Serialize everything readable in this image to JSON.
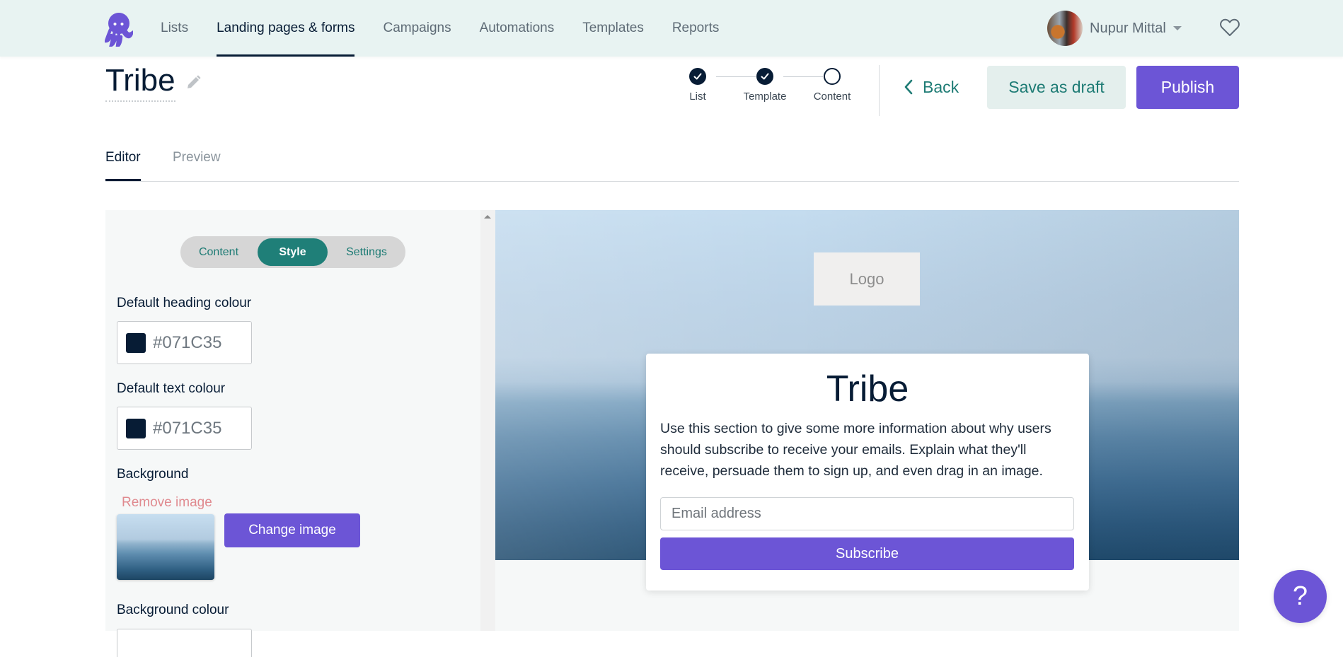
{
  "nav": {
    "logo": "octopus-logo",
    "items": [
      {
        "label": "Lists",
        "active": false
      },
      {
        "label": "Landing pages & forms",
        "active": true
      },
      {
        "label": "Campaigns",
        "active": false
      },
      {
        "label": "Automations",
        "active": false
      },
      {
        "label": "Templates",
        "active": false
      },
      {
        "label": "Reports",
        "active": false
      }
    ],
    "user_name": "Nupur Mittal"
  },
  "header": {
    "title": "Tribe",
    "steps": [
      {
        "label": "List",
        "state": "complete"
      },
      {
        "label": "Template",
        "state": "complete"
      },
      {
        "label": "Content",
        "state": "current"
      }
    ],
    "back_label": "Back",
    "draft_label": "Save as draft",
    "publish_label": "Publish"
  },
  "tabs": [
    {
      "label": "Editor",
      "active": true
    },
    {
      "label": "Preview",
      "active": false
    }
  ],
  "panel": {
    "segments": [
      {
        "label": "Content",
        "active": false
      },
      {
        "label": "Style",
        "active": true
      },
      {
        "label": "Settings",
        "active": false
      }
    ],
    "heading_colour_label": "Default heading colour",
    "heading_colour_value": "#071C35",
    "text_colour_label": "Default text colour",
    "text_colour_value": "#071C35",
    "background_label": "Background",
    "remove_image_label": "Remove image",
    "change_image_label": "Change image",
    "background_colour_label": "Background colour"
  },
  "preview": {
    "logo_placeholder": "Logo",
    "card_title": "Tribe",
    "card_text": "Use this section to give some more information about why users should subscribe to receive your emails. Explain what they'll receive, persuade them to sign up, and even drag in an image.",
    "email_placeholder": "Email address",
    "subscribe_label": "Subscribe"
  },
  "help": {
    "label": "?"
  },
  "colors": {
    "brand_purple": "#6C55D6",
    "teal": "#1F7F78",
    "navy": "#071C35",
    "nav_bg": "#E8F3F2"
  }
}
